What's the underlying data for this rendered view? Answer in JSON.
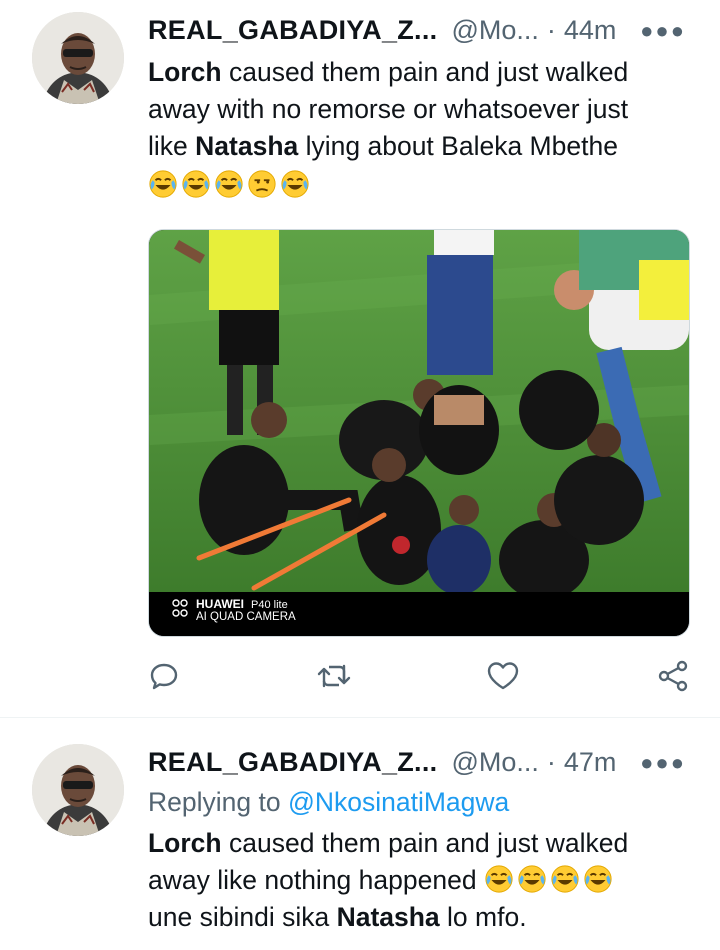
{
  "tweets": [
    {
      "display_name": "REAL_GABADIYA_Z...",
      "handle": "@Mo...",
      "separator": "·",
      "time": "44m",
      "more_icon": "more-horizontal-icon",
      "text": {
        "line1_bold": "Lorch",
        "line1_rest": " caused them pain and just walked",
        "line2": "away with no remorse or whatsoever just",
        "line3_pre": "like ",
        "line3_bold": "Natasha",
        "line3_rest": " lying about Baleka Mbethe"
      },
      "emojis": [
        "face-with-tears-of-joy",
        "face-with-tears-of-joy",
        "face-with-tears-of-joy",
        "unamused-face",
        "face-with-tears-of-joy"
      ],
      "media": {
        "watermark_line1": "HUAWEI P40 lite",
        "watermark_line2": "AI QUAD CAMERA",
        "watermark_brand": "HUAWEI",
        "watermark_model": "P40 lite"
      },
      "actions": [
        "reply-icon",
        "retweet-icon",
        "like-icon",
        "share-icon"
      ]
    },
    {
      "display_name": "REAL_GABADIYA_Z...",
      "handle": "@Mo...",
      "separator": "·",
      "time": "47m",
      "more_icon": "more-horizontal-icon",
      "replying_to_label": "Replying to ",
      "replying_to_handle": "@NkosinatiMagwa",
      "text": {
        "line1_bold": "Lorch",
        "line1_rest": " caused them pain and just walked",
        "line2": "away like nothing happened",
        "line3_pre": "une sibindi sika ",
        "line3_bold": "Natasha",
        "line3_rest": " lo mfo."
      },
      "emojis": [
        "face-with-tears-of-joy",
        "face-with-tears-of-joy",
        "face-with-tears-of-joy",
        "face-with-tears-of-joy"
      ]
    }
  ],
  "colors": {
    "text": "#0f1419",
    "secondary": "#536471",
    "link": "#1d9bf0",
    "divider": "#eff3f4"
  }
}
